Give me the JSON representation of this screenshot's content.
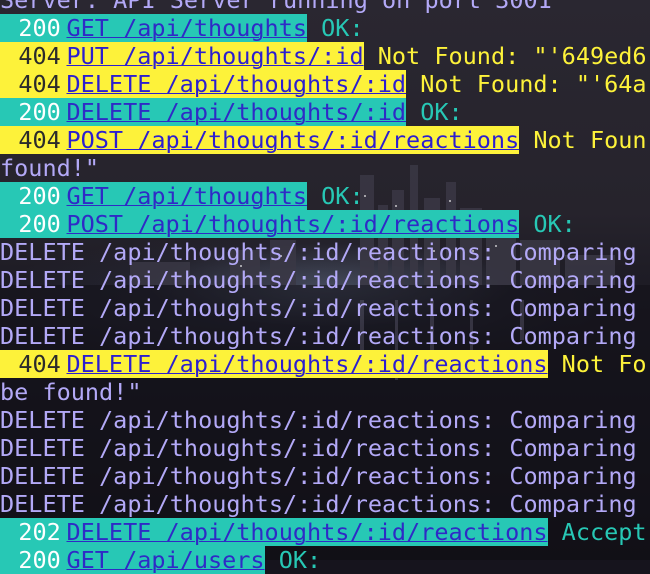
{
  "terminal": {
    "lines": [
      {
        "kind": "plain",
        "text": "Server: API Server running on port 3001"
      },
      {
        "kind": "ok",
        "status": "200",
        "request": "GET /api/thoughts",
        "message": " OK:"
      },
      {
        "kind": "err",
        "status": "404",
        "request": "PUT /api/thoughts/:id",
        "message": " Not Found: \"'649ed6"
      },
      {
        "kind": "err",
        "status": "404",
        "request": "DELETE /api/thoughts/:id",
        "message": " Not Found: \"'64a"
      },
      {
        "kind": "ok",
        "status": "200",
        "request": "DELETE /api/thoughts/:id",
        "message": " OK:"
      },
      {
        "kind": "err",
        "status": "404",
        "request": "POST /api/thoughts/:id/reactions",
        "message": " Not Foun"
      },
      {
        "kind": "cont",
        "text": "found!\""
      },
      {
        "kind": "ok",
        "status": "200",
        "request": "GET /api/thoughts",
        "message": " OK:"
      },
      {
        "kind": "ok",
        "status": "200",
        "request": "POST /api/thoughts/:id/reactions",
        "message": " OK:"
      },
      {
        "kind": "plain",
        "text": "DELETE /api/thoughts/:id/reactions: Comparing"
      },
      {
        "kind": "plain",
        "text": "DELETE /api/thoughts/:id/reactions: Comparing"
      },
      {
        "kind": "plain",
        "text": "DELETE /api/thoughts/:id/reactions: Comparing"
      },
      {
        "kind": "plain",
        "text": "DELETE /api/thoughts/:id/reactions: Comparing"
      },
      {
        "kind": "err",
        "status": "404",
        "request": "DELETE /api/thoughts/:id/reactions",
        "message": " Not Fo"
      },
      {
        "kind": "cont",
        "text": "be found!\""
      },
      {
        "kind": "plain",
        "text": "DELETE /api/thoughts/:id/reactions: Comparing"
      },
      {
        "kind": "plain",
        "text": "DELETE /api/thoughts/:id/reactions: Comparing"
      },
      {
        "kind": "plain",
        "text": "DELETE /api/thoughts/:id/reactions: Comparing"
      },
      {
        "kind": "plain",
        "text": "DELETE /api/thoughts/:id/reactions: Comparing"
      },
      {
        "kind": "ok",
        "status": "202",
        "request": "DELETE /api/thoughts/:id/reactions",
        "message": " Accept"
      },
      {
        "kind": "ok",
        "status": "200",
        "request": "GET /api/users",
        "message": " OK:"
      }
    ]
  },
  "colors": {
    "success_bg": "#27c8b5",
    "error_bg": "#fdf23a",
    "request_text": "#2f2ac6",
    "plain_text": "#b3a9f7"
  }
}
